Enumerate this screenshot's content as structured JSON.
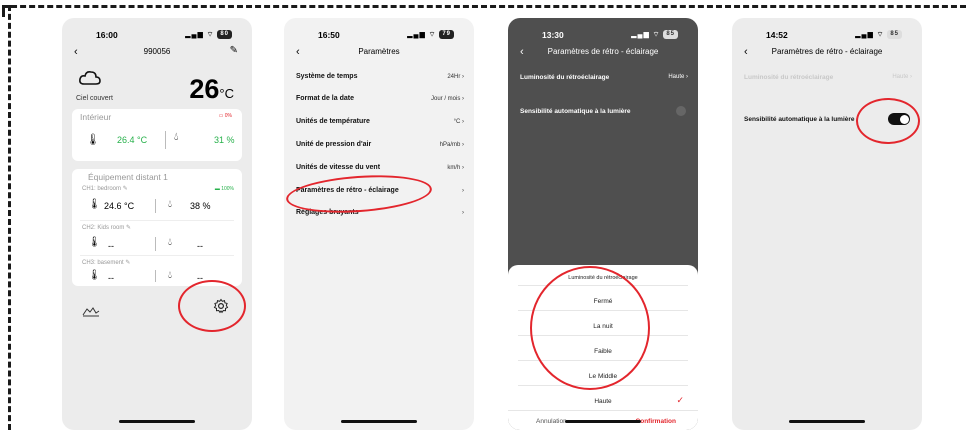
{
  "colors": {
    "highlight": "#e3262d",
    "green": "#27b14b",
    "dark_overlay": "#4f4f4f",
    "confirm": "#e3262d"
  },
  "screen1": {
    "status_time": "16:00",
    "battery": "80",
    "title": "990056",
    "weather_label": "Ciel couvert",
    "big_temp": "26",
    "big_temp_unit": "°C",
    "indoor": {
      "title": "Intérieur",
      "battery": "0%",
      "temp": "26.4 °C",
      "humidity": "31 %"
    },
    "remote": {
      "title": "Équipement distant 1",
      "battery": "100%",
      "channels": [
        {
          "label": "CH1: bedroom",
          "temp": "24.6 °C",
          "humidity": "38 %"
        },
        {
          "label": "CH2: Kids room",
          "temp": "--",
          "humidity": "--"
        },
        {
          "label": "CH3: basement",
          "temp": "--",
          "humidity": "--"
        }
      ]
    },
    "icons": {
      "chart": "chart-icon",
      "settings": "gear-icon",
      "back": "back-icon",
      "edit": "edit-icon"
    }
  },
  "screen2": {
    "status_time": "16:50",
    "battery": "79",
    "title": "Paramètres",
    "rows": [
      {
        "label": "Système de temps",
        "value": "24Hr"
      },
      {
        "label": "Format de la date",
        "value": "Jour / mois"
      },
      {
        "label": "Unités de température",
        "value": "°C"
      },
      {
        "label": "Unité de pression d'air",
        "value": "hPa/mb"
      },
      {
        "label": "Unités de vitesse du vent",
        "value": "km/h"
      },
      {
        "label": "Paramètres de rétro - éclairage",
        "value": ""
      },
      {
        "label": "Réglages bruyants",
        "value": ""
      }
    ]
  },
  "screen3": {
    "status_time": "13:30",
    "battery": "85",
    "title": "Paramètres de rétro - éclairage",
    "brightness_label": "Luminosité du rétroéclairage",
    "brightness_value": "Haute",
    "auto_label": "Sensibilité automatique à la lumière",
    "sheet_title": "Luminosité du rétroéclairage",
    "options": [
      "Fermé",
      "La nuit",
      "Faible",
      "Le Middle",
      "Haute"
    ],
    "selected_option": "Haute",
    "cancel": "Annulation",
    "confirm": "Confirmation"
  },
  "screen4": {
    "status_time": "14:52",
    "battery": "85",
    "title": "Paramètres de rétro - éclairage",
    "brightness_label": "Luminosité du rétroéclairage",
    "brightness_value": "Haute",
    "auto_label": "Sensibilité automatique à la lumière",
    "auto_enabled": true
  }
}
